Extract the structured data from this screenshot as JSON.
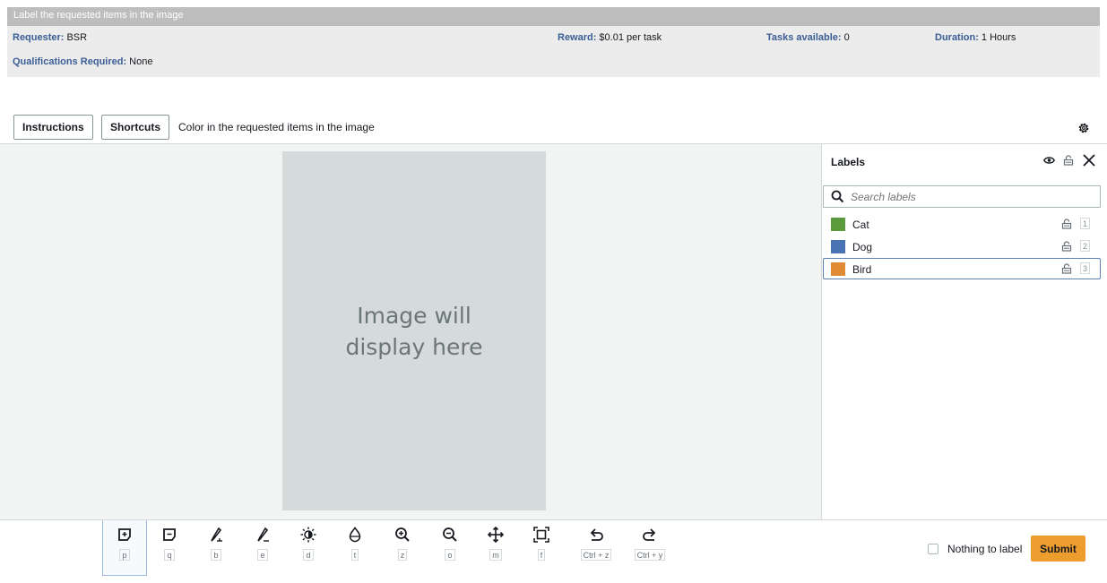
{
  "task": {
    "title": "Label the requested items in the image",
    "requester_key": "Requester:",
    "requester_value": "BSR",
    "reward_key": "Reward:",
    "reward_value": "$0.01 per task",
    "tasks_key": "Tasks available:",
    "tasks_value": "0",
    "duration_key": "Duration:",
    "duration_value": "1 Hours",
    "qual_key": "Qualifications Required:",
    "qual_value": "None"
  },
  "toolbar": {
    "instructions_label": "Instructions",
    "shortcuts_label": "Shortcuts",
    "instruction_text": "Color in the requested items in the image"
  },
  "canvas": {
    "placeholder_text": "Image will display here"
  },
  "labels_panel": {
    "title": "Labels",
    "search_placeholder": "Search labels",
    "items": [
      {
        "name": "Cat",
        "color": "#5a9a3c",
        "shortcut": "1"
      },
      {
        "name": "Dog",
        "color": "#4a73b6",
        "shortcut": "2"
      },
      {
        "name": "Bird",
        "color": "#e08a36",
        "shortcut": "3",
        "selected": true
      }
    ]
  },
  "tools": [
    {
      "name": "polygon-tool",
      "icon": "polygon-add-icon",
      "key": "p"
    },
    {
      "name": "polygon-subtract-tool",
      "icon": "polygon-subtract-icon",
      "key": "q"
    },
    {
      "name": "brush-tool",
      "icon": "brush-icon",
      "key": "b"
    },
    {
      "name": "eraser-tool",
      "icon": "eraser-icon",
      "key": "e"
    },
    {
      "name": "brightness-tool",
      "icon": "brightness-icon",
      "key": "d"
    },
    {
      "name": "transparency-tool",
      "icon": "droplet-icon",
      "key": "t"
    },
    {
      "name": "zoom-in-tool",
      "icon": "zoom-in-icon",
      "key": "z"
    },
    {
      "name": "zoom-out-tool",
      "icon": "zoom-out-icon",
      "key": "o"
    },
    {
      "name": "move-tool",
      "icon": "move-icon",
      "key": "m"
    },
    {
      "name": "fit-tool",
      "icon": "fit-screen-icon",
      "key": "f"
    },
    {
      "name": "undo-tool",
      "icon": "undo-icon",
      "key": "Ctrl + z"
    },
    {
      "name": "redo-tool",
      "icon": "redo-icon",
      "key": "Ctrl + y"
    }
  ],
  "footer": {
    "nothing_label": "Nothing to label",
    "submit_label": "Submit"
  },
  "colors": {
    "accent": "#ec9d2e",
    "label_key": "#3b5e95",
    "header_bar": "#bdbdbd"
  }
}
